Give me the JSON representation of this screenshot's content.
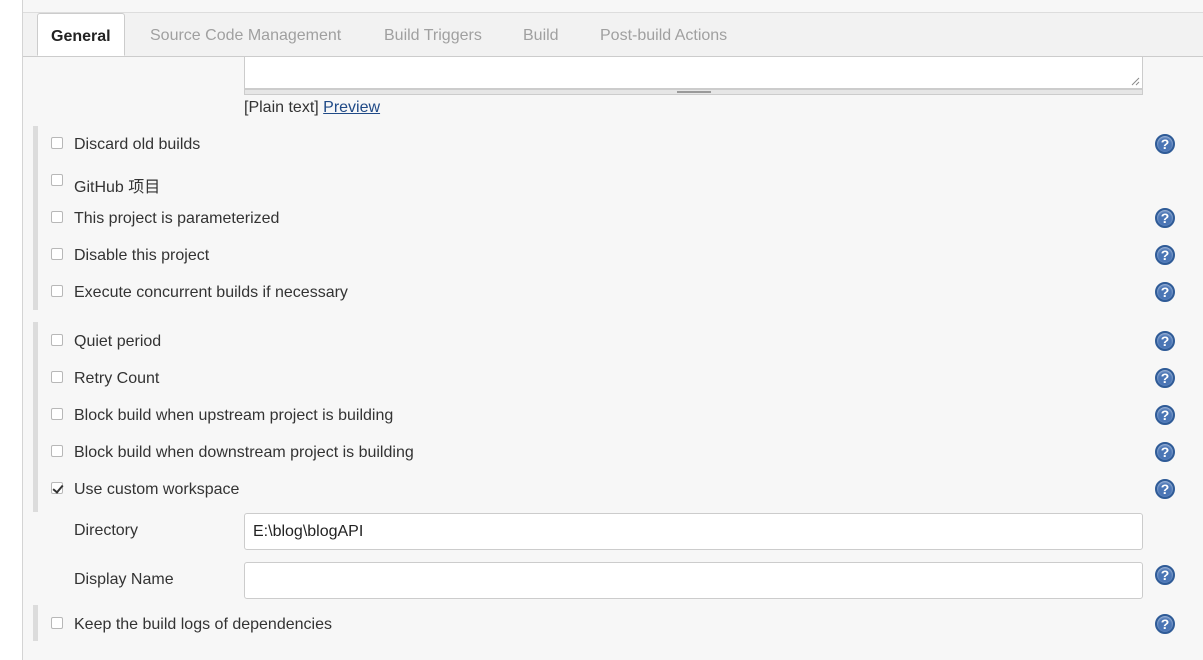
{
  "tabs": [
    {
      "label": "General",
      "active": true
    },
    {
      "label": "Source Code Management"
    },
    {
      "label": "Build Triggers"
    },
    {
      "label": "Build"
    },
    {
      "label": "Post-build Actions"
    }
  ],
  "description": {
    "format_text": "[Plain text]",
    "preview_link": "Preview"
  },
  "options": [
    {
      "label": "Discard old builds",
      "checked": false,
      "help": true
    },
    {
      "label": "GitHub 项目",
      "checked": false,
      "help": false
    },
    {
      "label": "This project is parameterized",
      "checked": false,
      "help": true
    },
    {
      "label": "Disable this project",
      "checked": false,
      "help": true
    },
    {
      "label": "Execute concurrent builds if necessary",
      "checked": false,
      "help": true
    },
    {
      "label": "Quiet period",
      "checked": false,
      "help": true
    },
    {
      "label": "Retry Count",
      "checked": false,
      "help": true
    },
    {
      "label": "Block build when upstream project is building",
      "checked": false,
      "help": true
    },
    {
      "label": "Block build when downstream project is building",
      "checked": false,
      "help": true
    },
    {
      "label": "Use custom workspace",
      "checked": true,
      "help": true
    },
    {
      "label": "Keep the build logs of dependencies",
      "checked": false,
      "help": true
    }
  ],
  "workspace": {
    "directory_label": "Directory",
    "directory_value": "E:\\blog\\blogAPI",
    "display_name_label": "Display Name",
    "display_name_value": ""
  },
  "help_glyph": "?",
  "icons": {
    "help": "question-circle-icon",
    "checkbox": "checkbox"
  },
  "colors": {
    "help_icon": "#4a75b5",
    "link": "#204a87",
    "panel_bg": "#f7f7f7"
  }
}
